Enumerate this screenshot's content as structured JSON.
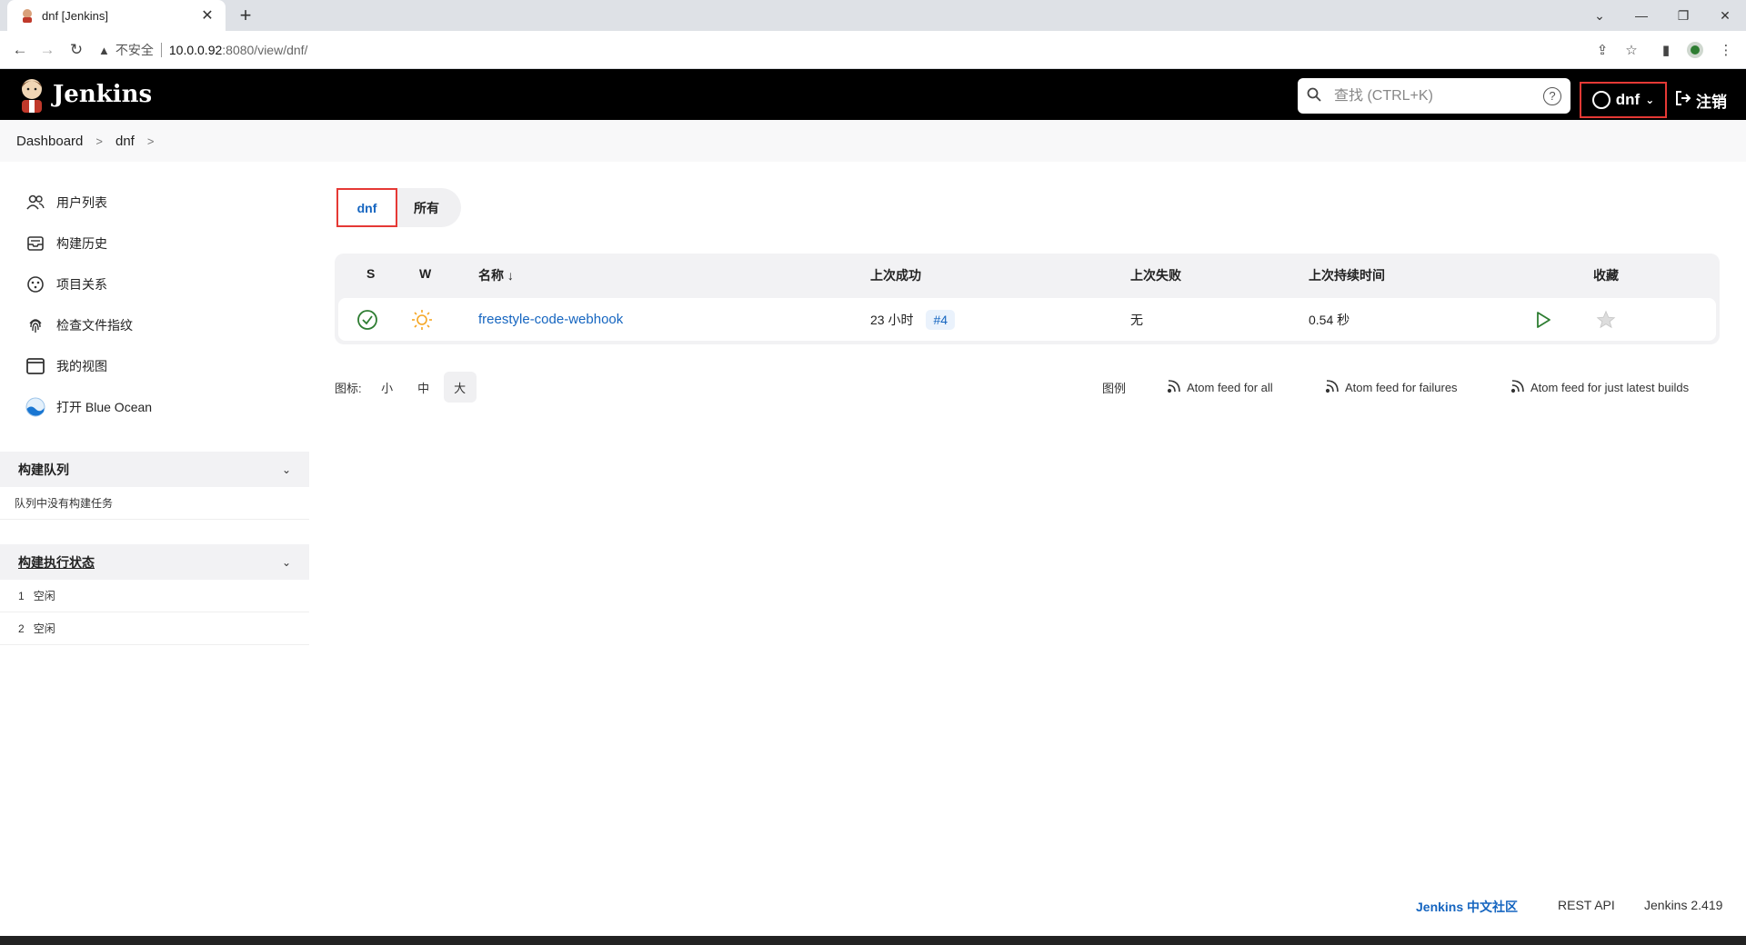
{
  "browser": {
    "tab_title": "dnf [Jenkins]",
    "tab_close": "✕",
    "new_tab": "+",
    "insecure_label": "不安全",
    "url_host": "10.0.0.92",
    "url_path": ":8080/view/dnf/"
  },
  "header": {
    "brand": "Jenkins",
    "search_placeholder": "查找 (CTRL+K)",
    "help": "?",
    "user": "dnf",
    "logout": "注销"
  },
  "breadcrumb": [
    "Dashboard",
    "dnf"
  ],
  "sidebar": {
    "items": [
      {
        "label": "用户列表",
        "icon": "people-icon"
      },
      {
        "label": "构建历史",
        "icon": "history-icon"
      },
      {
        "label": "项目关系",
        "icon": "relationship-icon"
      },
      {
        "label": "检查文件指纹",
        "icon": "fingerprint-icon"
      },
      {
        "label": "我的视图",
        "icon": "window-icon"
      },
      {
        "label": "打开 Blue Ocean",
        "icon": "blue-ocean-icon"
      }
    ],
    "build_queue": {
      "title": "构建队列",
      "empty": "队列中没有构建任务"
    },
    "executors": {
      "title": "构建执行状态",
      "rows": [
        {
          "num": "1",
          "status": "空闲"
        },
        {
          "num": "2",
          "status": "空闲"
        }
      ]
    }
  },
  "view_tabs": [
    {
      "label": "dnf",
      "active": true
    },
    {
      "label": "所有",
      "active": false
    }
  ],
  "table": {
    "headers": {
      "s": "S",
      "w": "W",
      "name": "名称 ↓",
      "last_success": "上次成功",
      "last_failure": "上次失败",
      "last_duration": "上次持续时间",
      "favorite": "收藏"
    },
    "rows": [
      {
        "name": "freestyle-code-webhook",
        "last_success": "23 小时",
        "build": "#4",
        "last_failure": "无",
        "duration": "0.54 秒"
      }
    ]
  },
  "icon_size": {
    "label": "图标:",
    "options": [
      "小",
      "中",
      "大"
    ],
    "selected": "大"
  },
  "feeds": {
    "legend": "图例",
    "all": "Atom feed for all",
    "failures": "Atom feed for failures",
    "latest": "Atom feed for just latest builds"
  },
  "footer": {
    "community": "Jenkins 中文社区",
    "rest_api": "REST API",
    "version": "Jenkins 2.419"
  },
  "colors": {
    "accent": "#1565c0",
    "highlight": "#e53935",
    "success": "#2e7d32",
    "weather": "#f5a623"
  }
}
